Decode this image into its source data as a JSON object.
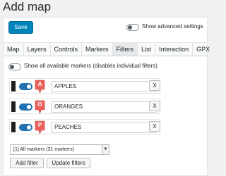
{
  "page": {
    "title": "Add map"
  },
  "toolbar": {
    "save_label": "Save",
    "advanced_label": "Show advanced settings"
  },
  "tabs": [
    {
      "label": "Map",
      "active": false
    },
    {
      "label": "Layers",
      "active": false
    },
    {
      "label": "Controls",
      "active": false
    },
    {
      "label": "Markers",
      "active": false
    },
    {
      "label": "Filters",
      "active": true
    },
    {
      "label": "List",
      "active": false
    },
    {
      "label": "Interaction",
      "active": false
    },
    {
      "label": "GPX",
      "active": false
    }
  ],
  "filters_panel": {
    "show_all_label": "Show all available markers (disables individual filters)",
    "rows": [
      {
        "letter": "A",
        "name": "APPLES",
        "remove_label": "X"
      },
      {
        "letter": "O",
        "name": "ORANGES",
        "remove_label": "X"
      },
      {
        "letter": "P",
        "name": "PEACHES",
        "remove_label": "X"
      }
    ],
    "select_value": "[1] All markers (31 markers)",
    "add_label": "Add filter",
    "update_label": "Update filters"
  },
  "colors": {
    "primary": "#0085ba",
    "toggle_on": "#2271b1",
    "marker": "#e9605a"
  }
}
